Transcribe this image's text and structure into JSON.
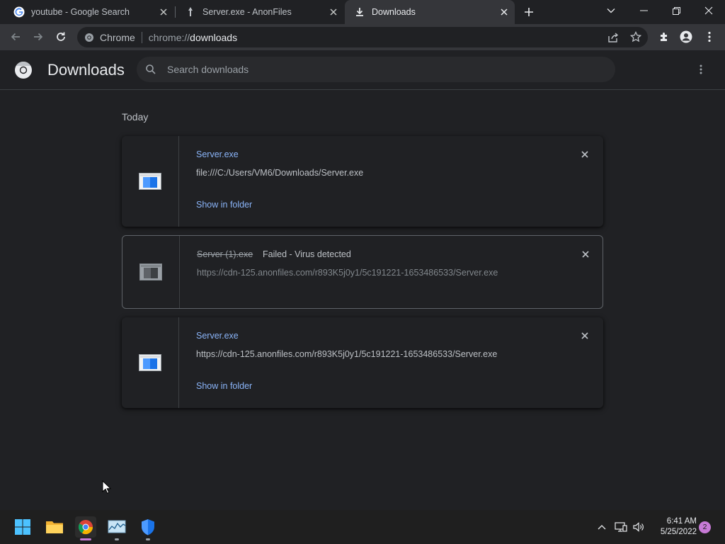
{
  "tabs": [
    {
      "title": "youtube - Google Search",
      "icon": "google-g-icon"
    },
    {
      "title": "Server.exe - AnonFiles",
      "icon": "anonfiles-icon"
    },
    {
      "title": "Downloads",
      "icon": "download-icon",
      "active": true
    }
  ],
  "omnibox": {
    "site_label": "Chrome",
    "url_scheme": "chrome://",
    "url_host": "downloads"
  },
  "header": {
    "title": "Downloads",
    "search_placeholder": "Search downloads"
  },
  "downloads": {
    "date_label": "Today",
    "items": [
      {
        "name": "Server.exe",
        "path": "file:///C:/Users/VM6/Downloads/Server.exe",
        "action": "Show in folder",
        "status": ""
      },
      {
        "name": "Server (1).exe",
        "path": "https://cdn-125.anonfiles.com/r893K5j0y1/5c191221-1653486533/Server.exe",
        "action": "",
        "status": "Failed - Virus detected"
      },
      {
        "name": "Server.exe",
        "path": "https://cdn-125.anonfiles.com/r893K5j0y1/5c191221-1653486533/Server.exe",
        "action": "Show in folder",
        "status": ""
      }
    ]
  },
  "taskbar": {
    "apps": [
      "start-icon",
      "file-explorer-icon",
      "chrome-icon",
      "resource-monitor-icon",
      "defender-icon"
    ],
    "time": "6:41 AM",
    "date": "5/25/2022",
    "notifications": "2"
  },
  "colors": {
    "link": "#8ab4f8",
    "background": "#202124",
    "toolbar": "#35363a",
    "accent": "#c77ad6"
  }
}
